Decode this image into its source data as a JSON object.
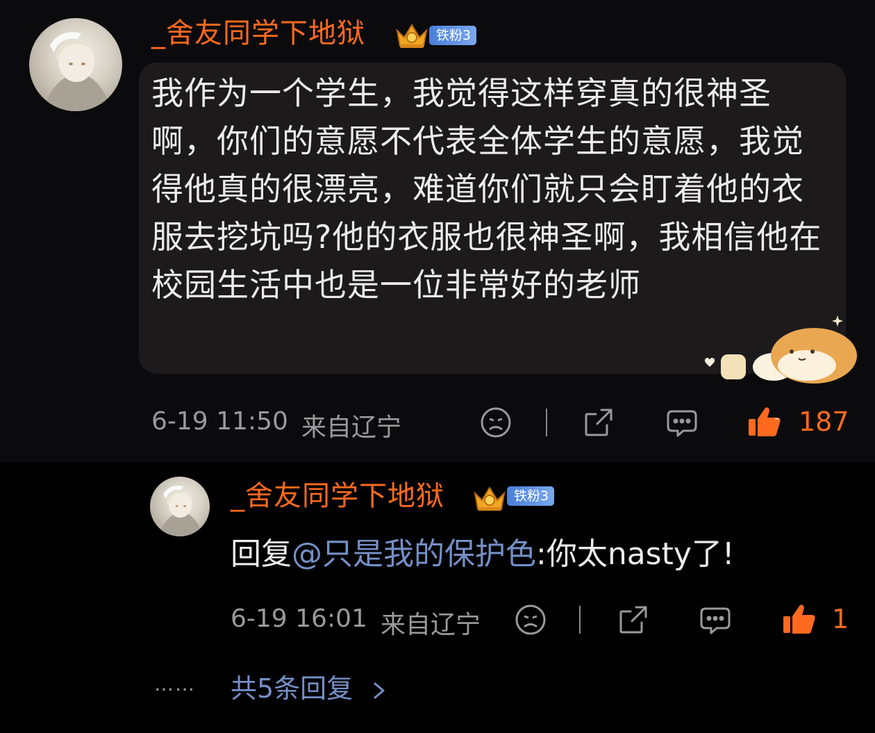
{
  "comment": {
    "username": "_舍友同学下地狱",
    "badge": "铁粉3",
    "text": "我作为一个学生，我觉得这样穿真的很神圣啊，你们的意愿不代表全体学生的意愿，我觉得他真的很漂亮，难道你们就只会盯着他的衣服去挖坑吗?他的衣服也很神圣啊，我相信他在校园生活中也是一位非常好的老师",
    "time": "6-19 11:50",
    "location": "来自辽宁",
    "likes": "187"
  },
  "reply": {
    "username": "_舍友同学下地狱",
    "badge": "铁粉3",
    "prefix": "回复",
    "mention": "@只是我的保护色",
    "body": ":你太nasty了!",
    "time": "6-19 16:01",
    "location": "来自辽宁",
    "likes": "1"
  },
  "more": {
    "dots": "……",
    "label": "共5条回复"
  },
  "icons": {
    "dislike": "sad-face-icon",
    "share": "share-icon",
    "reply": "comment-icon",
    "like": "thumbs-up-icon",
    "expand": "chevron-right-icon",
    "sticker": "shiba-bread-sticker"
  },
  "colors": {
    "username": "#ff6a1f",
    "like_active": "#ff6a1f",
    "mention": "#7590c7",
    "badge": "#5b8ee0",
    "bubble": "#1c1a1b"
  }
}
